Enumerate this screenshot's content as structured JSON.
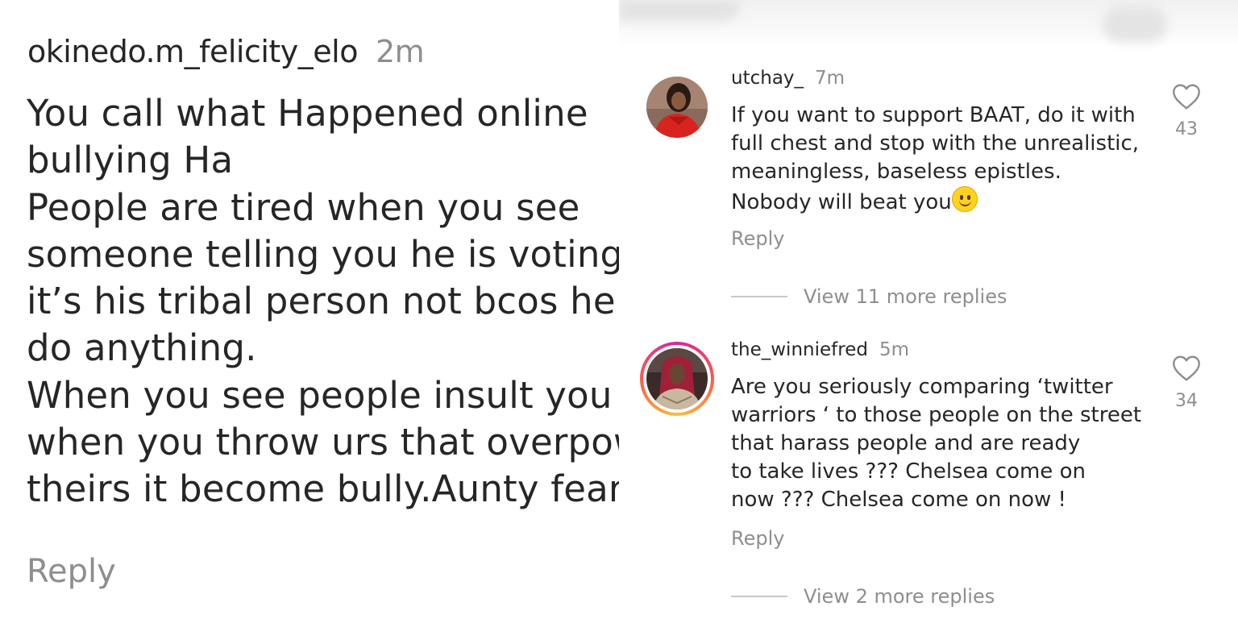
{
  "left_panel": {
    "username": "okinedo.m_felicity_elo",
    "time": "2m",
    "text_lines": [
      "You call what Happened online",
      "bullying Ha",
      "People are tired when you see",
      "someone telling you he is voting b",
      "it’s his tribal person not bcos he c",
      "do anything.",
      "When you see people insult you a",
      "when you throw urs that overpow",
      "theirs it become bully.Aunty fear ("
    ],
    "reply_label": "Reply"
  },
  "right_panel": {
    "comments": [
      {
        "username": "utchay_",
        "time": "7m",
        "text_lines": [
          "If you want to support BAAT, do it with",
          "full chest and stop with the unrealistic,",
          "meaningless, baseless epistles.",
          "Nobody will beat you"
        ],
        "emoji": "slightly-smiling-face",
        "reply_label": "Reply",
        "likes": "43",
        "view_more": "View 11 more replies"
      },
      {
        "username": "the_winniefred",
        "time": "5m",
        "text_lines": [
          "Are you seriously comparing ‘twitter",
          "warriors ‘ to those people on the street",
          "that harass people and are ready",
          "to take lives ??? Chelsea come on",
          "now ??? Chelsea come on now !"
        ],
        "reply_label": "Reply",
        "likes": "34",
        "view_more": "View 2 more replies",
        "has_story_ring": true
      }
    ]
  },
  "colors": {
    "text_primary": "#262626",
    "text_secondary": "#8e8e8e",
    "divider": "#c7c7c7"
  }
}
